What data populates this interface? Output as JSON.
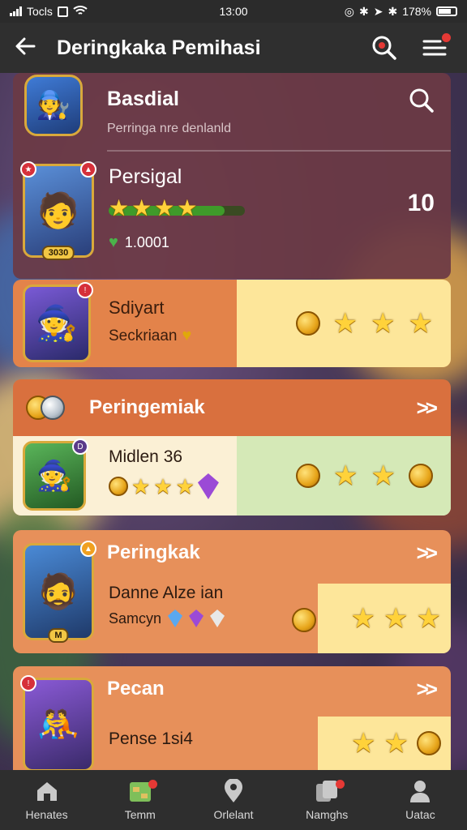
{
  "status": {
    "carrier": "Tocls",
    "time": "13:00",
    "battery": "178%"
  },
  "appbar": {
    "title": "Deringkaka Pemihasi"
  },
  "header_card": {
    "title": "Basdial",
    "subtitle": "Perringa nre denlanld"
  },
  "player": {
    "name": "Persigal",
    "level_badge": "3030",
    "score_label": "1.0001",
    "rank": "10",
    "stars": 4,
    "progress": 0.85
  },
  "reward1": {
    "name": "Sdiyart",
    "sub": "Seckriaan"
  },
  "section2": {
    "title": "Peringemiak",
    "chevron": ">>",
    "row_name": "Midlen 36"
  },
  "section3": {
    "title": "Peringkak",
    "chevron": ">>",
    "row_name": "Danne Alze ian",
    "row_sub": "Samcyn",
    "level_badge": "M"
  },
  "section4": {
    "title": "Pecan",
    "chevron": ">>",
    "row_name": "Pense 1si4"
  },
  "nav": [
    {
      "label": "Henates",
      "icon": "house-icon"
    },
    {
      "label": "Temm",
      "icon": "map-icon"
    },
    {
      "label": "Orlelant",
      "icon": "location-pin-icon"
    },
    {
      "label": "Namghs",
      "icon": "cards-icon"
    },
    {
      "label": "Uatac",
      "icon": "profile-icon"
    }
  ],
  "colors": {
    "maroon": "#6b3a44",
    "orange": "#e3834a",
    "cream": "#fde69a",
    "mint": "#d5e9b7",
    "section": "#d9703e"
  }
}
